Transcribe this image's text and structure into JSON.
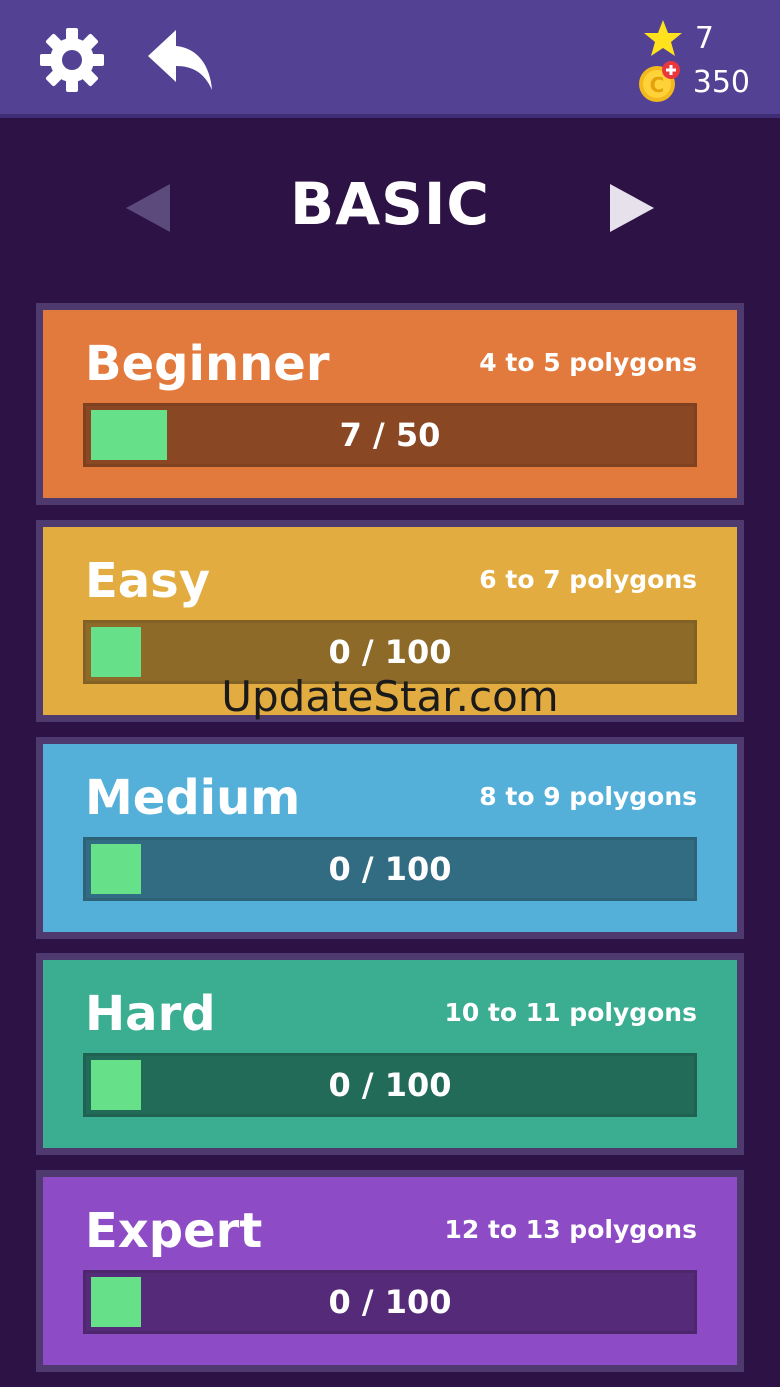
{
  "header": {
    "settings_icon": "gear-icon",
    "back_icon": "undo-arrow-icon",
    "stars": "7",
    "coins": "350"
  },
  "nav": {
    "title": "BASIC",
    "prev_icon": "triangle-left-icon",
    "next_icon": "triangle-right-icon"
  },
  "levels": [
    {
      "title": "Beginner",
      "subtitle": "4 to 5 polygons",
      "progress_text": "7 / 50",
      "progress": 0.14,
      "color": "#e37a3d",
      "bar_color": "#8a4723"
    },
    {
      "title": "Easy",
      "subtitle": "6 to 7 polygons",
      "progress_text": "0 / 100",
      "progress": 0.0,
      "color": "#e3ac41",
      "bar_color": "#8d6a28"
    },
    {
      "title": "Medium",
      "subtitle": "8 to 9 polygons",
      "progress_text": "0 / 100",
      "progress": 0.0,
      "color": "#54b0d8",
      "bar_color": "#326c82"
    },
    {
      "title": "Hard",
      "subtitle": "10 to 11 polygons",
      "progress_text": "0 / 100",
      "progress": 0.0,
      "color": "#3bae91",
      "bar_color": "#236b59"
    },
    {
      "title": "Expert",
      "subtitle": "12 to 13 polygons",
      "progress_text": "0 / 100",
      "progress": 0.0,
      "color": "#8e4bc6",
      "bar_color": "#552a78"
    }
  ],
  "watermark": "UpdateStar.com"
}
